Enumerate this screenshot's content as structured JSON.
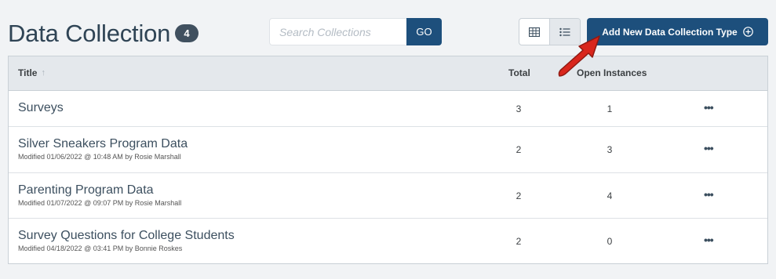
{
  "header": {
    "title": "Data Collection",
    "count": "4",
    "search_placeholder": "Search Collections",
    "search_value": "",
    "go_label": "GO",
    "add_label": "Add New Data Collection Type",
    "grid_view_icon": "grid-icon",
    "list_view_icon": "list-icon",
    "active_view": "list"
  },
  "table": {
    "columns": {
      "title": "Title",
      "total": "Total",
      "open": "Open Instances"
    },
    "rows": [
      {
        "title": "Surveys",
        "meta": "",
        "total": "3",
        "open": "1"
      },
      {
        "title": "Silver Sneakers Program Data",
        "meta": "Modified 01/06/2022 @ 10:48 AM by Rosie Marshall",
        "total": "2",
        "open": "3"
      },
      {
        "title": "Parenting Program Data",
        "meta": "Modified 01/07/2022 @ 09:07 PM by Rosie Marshall",
        "total": "2",
        "open": "4"
      },
      {
        "title": "Survey Questions for College Students",
        "meta": "Modified 04/18/2022 @ 03:41 PM by Bonnie Roskes",
        "total": "2",
        "open": "0"
      }
    ]
  },
  "colors": {
    "primary": "#1d4f7c",
    "badge": "#40505f",
    "annotation_arrow": "#d9261c"
  }
}
